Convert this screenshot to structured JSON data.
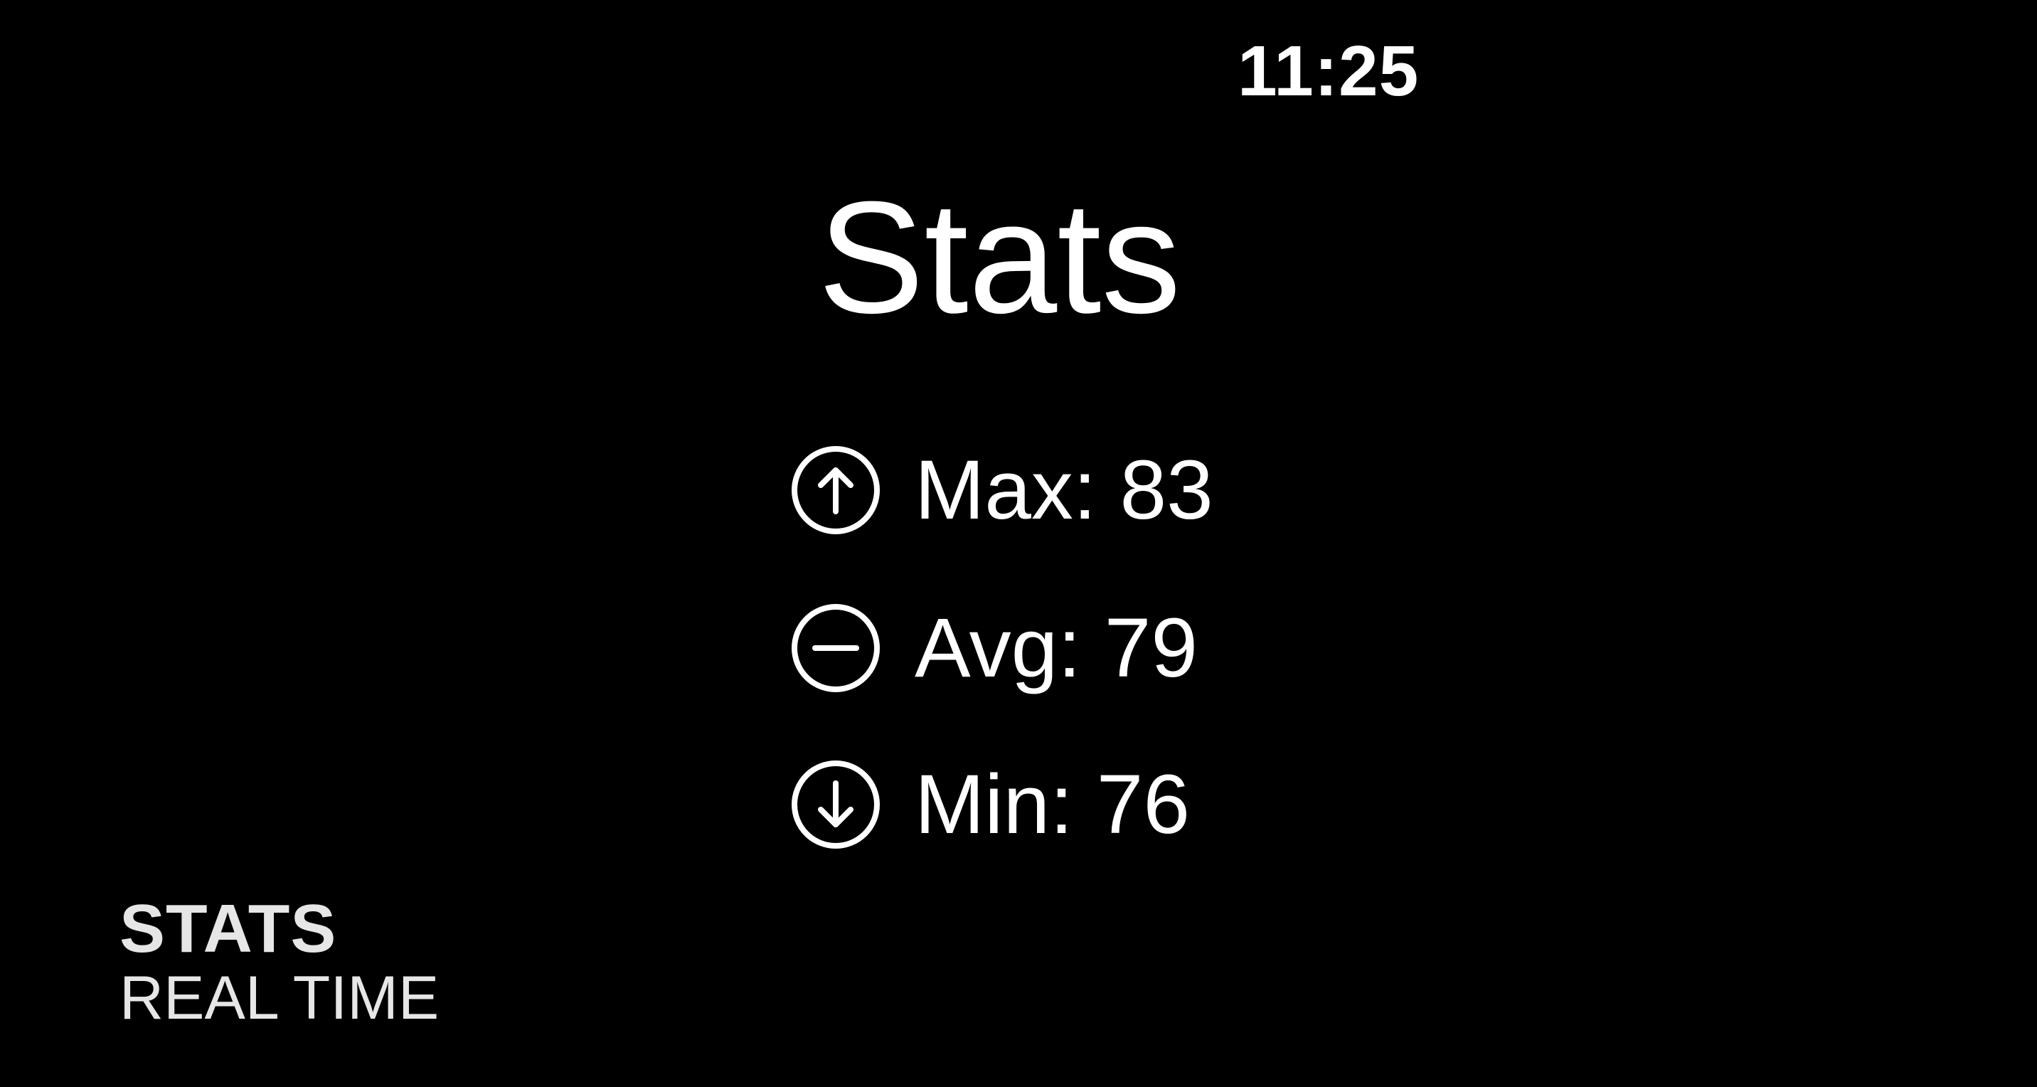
{
  "status_bar": {
    "time": "11:25"
  },
  "screen": {
    "title": "Stats"
  },
  "stats": [
    {
      "label": "Max: 83",
      "icon": "arrow-up-circle-icon"
    },
    {
      "label": "Avg: 79",
      "icon": "minus-circle-icon"
    },
    {
      "label": "Min: 76",
      "icon": "arrow-down-circle-icon"
    }
  ],
  "footer": {
    "title": "STATS",
    "subtitle": "REAL TIME"
  },
  "colors": {
    "background": "#000000",
    "foreground": "#ffffff"
  }
}
